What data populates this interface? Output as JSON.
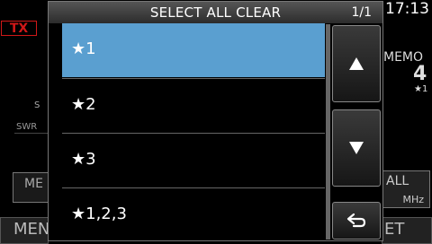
{
  "status": {
    "tx": "TX",
    "clock": "17:13"
  },
  "background": {
    "memo_label": "MEMO",
    "memo_number": "4",
    "memo_star": "★1",
    "s_label": "S",
    "swr_label": "SWR",
    "me_label": "ME",
    "men_label": "MEN",
    "all_label": "ALL",
    "mhz_label": "MHz",
    "et_label": "ET"
  },
  "dialog": {
    "title": "SELECT ALL CLEAR",
    "page_indicator": "1/1",
    "items": [
      {
        "label": "★1",
        "selected": true
      },
      {
        "label": "★2",
        "selected": false
      },
      {
        "label": "★3",
        "selected": false
      },
      {
        "label": "★1,2,3",
        "selected": false
      }
    ],
    "buttons": {
      "up": "up-arrow-icon",
      "down": "down-arrow-icon",
      "back": "return-arrow-icon"
    }
  },
  "colors": {
    "selected": "#5a9fd0",
    "tx": "#d01818",
    "background": "#000000"
  }
}
